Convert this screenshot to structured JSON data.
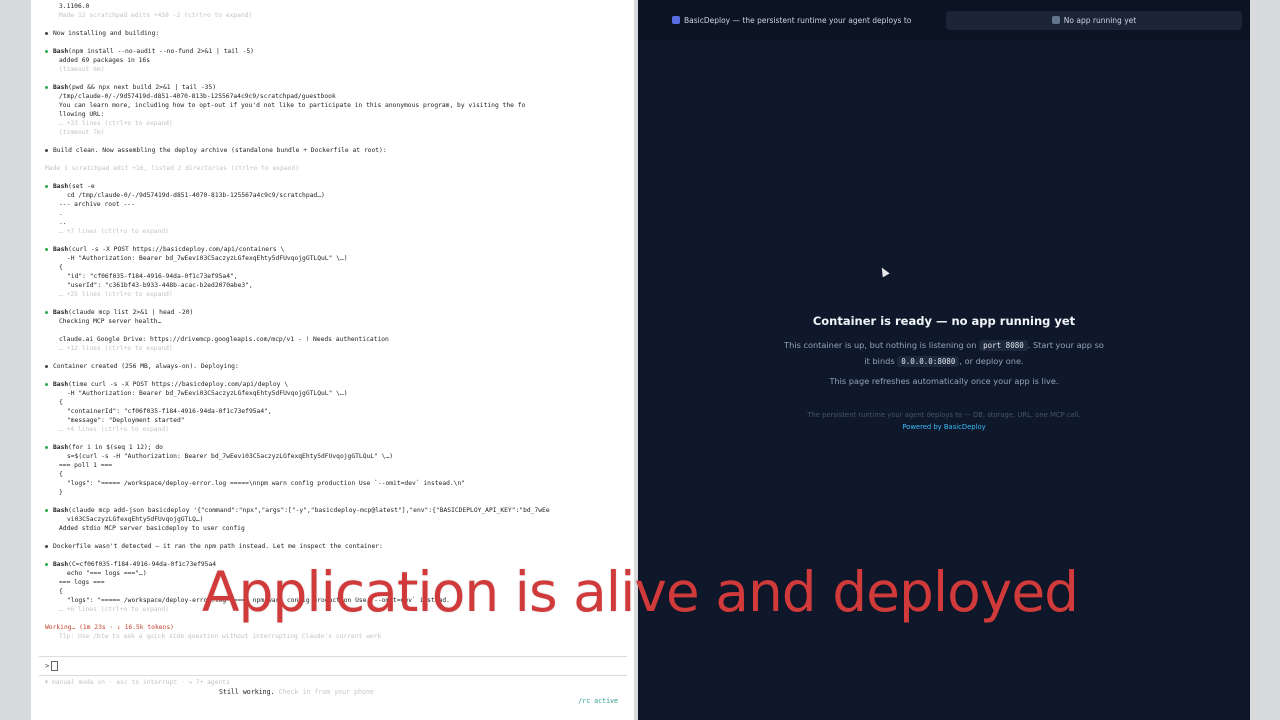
{
  "terminal": {
    "lines": [
      {
        "text": "3.1106.0",
        "cls": "ind"
      },
      {
        "text": "Made 12 scratchpad edits +458 -2 (ctrl+o to expand)",
        "cls": "dim ind"
      },
      {
        "text": "",
        "cls": "gap"
      },
      {
        "text": "Now installing and building:",
        "cls": "msg"
      },
      {
        "text": "",
        "cls": "gap"
      },
      {
        "tool": "Bash",
        "text": "(npm install --no-audit --no-fund 2>&1 | tail -5)",
        "cls": "tool"
      },
      {
        "text": "added 69 packages in 16s",
        "cls": "ind"
      },
      {
        "text": "(timeout 6m)",
        "cls": "dim ind"
      },
      {
        "text": "",
        "cls": "gap"
      },
      {
        "tool": "Bash",
        "text": "(pwd && npx next build 2>&1 | tail -35)",
        "cls": "tool"
      },
      {
        "text": "/tmp/claude-0/-/9d57419d-d851-4070-813b-125567a4c9c9/scratchpad/guestbook",
        "cls": "ind"
      },
      {
        "text": "You can learn more, including how to opt-out if you'd not like to participate in this anonymous program, by visiting the fo",
        "cls": "ind"
      },
      {
        "text": "llowing URL:",
        "cls": "ind"
      },
      {
        "text": "… +33 lines (ctrl+o to expand)",
        "cls": "dim ind"
      },
      {
        "text": "(timeout 7m)",
        "cls": "dim ind"
      },
      {
        "text": "",
        "cls": "gap"
      },
      {
        "text": "Build clean. Now assembling the deploy archive (standalone bundle + Dockerfile at root):",
        "cls": "msg"
      },
      {
        "text": "",
        "cls": "gap"
      },
      {
        "text": "Made 1 scratchpad edit +16, listed 2 directories (ctrl+o to expand)",
        "cls": "dim"
      },
      {
        "text": "",
        "cls": "gap"
      },
      {
        "tool": "Bash",
        "text": "(set -e",
        "cls": "tool"
      },
      {
        "text": "cd /tmp/claude-0/-/9d57419d-d851-4070-813b-125567a4c9c9/scratchpad…)",
        "cls": "ind2"
      },
      {
        "text": "--- archive root ---",
        "cls": "ind"
      },
      {
        "text": ".",
        "cls": "ind"
      },
      {
        "text": "..",
        "cls": "ind"
      },
      {
        "text": "… +7 lines (ctrl+o to expand)",
        "cls": "dim ind"
      },
      {
        "text": "",
        "cls": "gap"
      },
      {
        "tool": "Bash",
        "text": "(curl -s -X POST https://basicdeploy.com/api/containers \\",
        "cls": "tool"
      },
      {
        "text": "-H \"Authorization: Bearer bd_7wEevi03C5aczyzLGfexqEhty5dFUvqojgGTLQuL\" \\…)",
        "cls": "ind2"
      },
      {
        "text": "{",
        "cls": "ind"
      },
      {
        "text": "\"id\": \"cf06f035-f184-4916-94da-0f1c73ef95a4\",",
        "cls": "ind2"
      },
      {
        "text": "\"userId\": \"c361bf43-b933-448b-acac-b2ed2070abe3\",",
        "cls": "ind2"
      },
      {
        "text": "… +25 lines (ctrl+o to expand)",
        "cls": "dim ind"
      },
      {
        "text": "",
        "cls": "gap"
      },
      {
        "tool": "Bash",
        "text": "(claude mcp list 2>&1 | head -20)",
        "cls": "tool"
      },
      {
        "text": "Checking MCP server health…",
        "cls": "ind"
      },
      {
        "text": "",
        "cls": "gap"
      },
      {
        "text": "claude.ai Google Drive: https://drivemcp.googleapis.com/mcp/v1 - ! Needs authentication",
        "cls": "ind"
      },
      {
        "text": "… +12 lines (ctrl+o to expand)",
        "cls": "dim ind"
      },
      {
        "text": "",
        "cls": "gap"
      },
      {
        "text": "Container created (256 MB, always-on). Deploying:",
        "cls": "msg"
      },
      {
        "text": "",
        "cls": "gap"
      },
      {
        "tool": "Bash",
        "text": "(time curl -s -X POST https://basicdeploy.com/api/deploy \\",
        "cls": "tool"
      },
      {
        "text": "-H \"Authorization: Bearer bd_7wEevi03C5aczyzLGfexqEhty5dFUvqojgGTLQuL\" \\…)",
        "cls": "ind2"
      },
      {
        "text": "{",
        "cls": "ind"
      },
      {
        "text": "\"containerId\": \"cf06f035-f184-4916-94da-0f1c73ef95a4\",",
        "cls": "ind2"
      },
      {
        "text": "\"message\": \"Deployment started\"",
        "cls": "ind2"
      },
      {
        "text": "… +4 lines (ctrl+o to expand)",
        "cls": "dim ind"
      },
      {
        "text": "",
        "cls": "gap"
      },
      {
        "tool": "Bash",
        "text": "(for i in $(seq 1 12); do",
        "cls": "tool"
      },
      {
        "text": "s=$(curl -s -H \"Authorization: Bearer bd_7wEevi03C5aczyzLGfexqEhty5dFUvqojgGTLQuL\" \\…)",
        "cls": "ind2"
      },
      {
        "text": "=== poll 1 ===",
        "cls": "ind"
      },
      {
        "text": "{",
        "cls": "ind"
      },
      {
        "text": "\"logs\": \"===== /workspace/deploy-error.log =====\\nnpm warn config production Use `--omit=dev` instead.\\n\"",
        "cls": "ind2"
      },
      {
        "text": "}",
        "cls": "ind"
      },
      {
        "text": "",
        "cls": "gap"
      },
      {
        "tool": "Bash",
        "text": "(claude mcp add-json basicdeploy '{\"command\":\"npx\",\"args\":[\"-y\",\"basicdeploy-mcp@latest\"],\"env\":{\"BASICDEPLOY_API_KEY\":\"bd_7wEe",
        "cls": "tool"
      },
      {
        "text": "vi03C5aczyzLGfexqEhty5dFUvqojgGTLQ…)",
        "cls": "ind2"
      },
      {
        "text": "Added stdio MCP server basicdeploy to user config",
        "cls": "ind"
      },
      {
        "text": "",
        "cls": "gap"
      },
      {
        "text": "Dockerfile wasn't detected — it ran the npm path instead. Let me inspect the container:",
        "cls": "msg"
      },
      {
        "text": "",
        "cls": "gap"
      },
      {
        "tool": "Bash",
        "text": "(C=cf06f035-f184-4916-94da-0f1c73ef95a4",
        "cls": "tool"
      },
      {
        "text": "echo \"=== logs ===\"…)",
        "cls": "ind2"
      },
      {
        "text": "=== logs ===",
        "cls": "ind"
      },
      {
        "text": "{",
        "cls": "ind"
      },
      {
        "text": "\"logs\": \"===== /workspace/deploy-error.log ===== npm warn config production Use `--omit=dev` instead.",
        "cls": "ind2"
      },
      {
        "text": "… +6 lines (ctrl+o to expand)",
        "cls": "dim ind"
      },
      {
        "text": "",
        "cls": "gap"
      },
      {
        "text": "Working… (1m 23s · ↓ 16.5k tokens)",
        "cls": "working"
      },
      {
        "text": "Tip: Use /btw to ask a quick side question without interrupting Claude's current work",
        "cls": "dim ind"
      }
    ],
    "prompt_char": ">",
    "mode_line": "⏵ manual mode on · esc to interrupt · ⤷ 7+ agents",
    "status_strong": "Still working.",
    "status_faint": " Check in from your phone",
    "rc_active": "/rc active"
  },
  "browser": {
    "tabs": [
      {
        "label": "BasicDeploy — the persistent runtime your agent deploys to"
      },
      {
        "label": "No app running yet"
      }
    ],
    "page": {
      "title": "Container is ready — no app running yet",
      "desc_1": "This container is up, but nothing is listening on",
      "port": "port 8080",
      "desc_2": ". Start your app so it binds",
      "bind": "0.0.0.0:8080",
      "desc_3": ", or deploy one.",
      "refresh": "This page refreshes automatically once your app is live.",
      "tagline": "The persistent runtime your agent deploys to — DB, storage, URL, one MCP call.",
      "powered": "Powered by BasicDeploy"
    }
  },
  "caption": "Application is alive and deployed",
  "colors": {
    "caption": "#d13a3a",
    "page_bg": "#0f172a",
    "accent_link": "#38bdf8",
    "tool_dot": "#2fa84f"
  }
}
